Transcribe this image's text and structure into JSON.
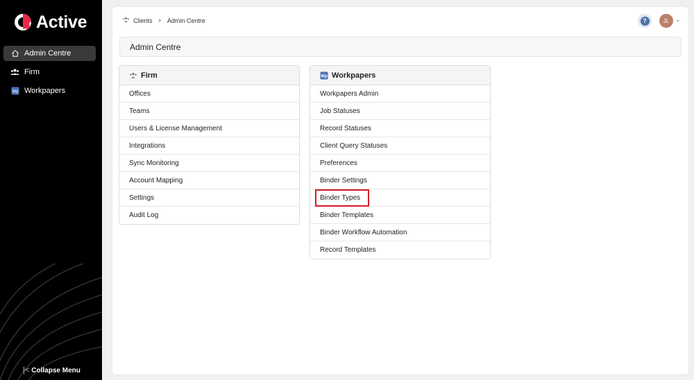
{
  "app": {
    "brand": "Active"
  },
  "sidebar": {
    "items": [
      {
        "label": "Admin Centre",
        "icon": "home-icon",
        "active": true
      },
      {
        "label": "Firm",
        "icon": "people-icon",
        "active": false
      },
      {
        "label": "Workpapers",
        "icon": "workpapers-icon",
        "active": false
      }
    ],
    "collapse_label": "Collapse Menu"
  },
  "breadcrumb": {
    "items": [
      "Clients",
      "Admin Centre"
    ]
  },
  "user": {
    "initials": "JL",
    "help_label": "?"
  },
  "page": {
    "title": "Admin Centre"
  },
  "panels": {
    "firm": {
      "title": "Firm",
      "items": [
        "Offices",
        "Teams",
        "Users & License Management",
        "Integrations",
        "Sync Monitoring",
        "Account Mapping",
        "Settings",
        "Audit Log"
      ]
    },
    "workpapers": {
      "title": "Workpapers",
      "icon_text": "Wp",
      "items": [
        "Workpapers Admin",
        "Job Statuses",
        "Record Statuses",
        "Client Query Statuses",
        "Preferences",
        "Binder Settings",
        "Binder Types",
        "Binder Templates",
        "Binder Workflow Automation",
        "Record Templates"
      ],
      "highlighted_item": "Binder Types"
    }
  },
  "colors": {
    "brand_red": "#e8294a",
    "highlight": "#d31d24",
    "sidebar_bg": "#000000"
  }
}
